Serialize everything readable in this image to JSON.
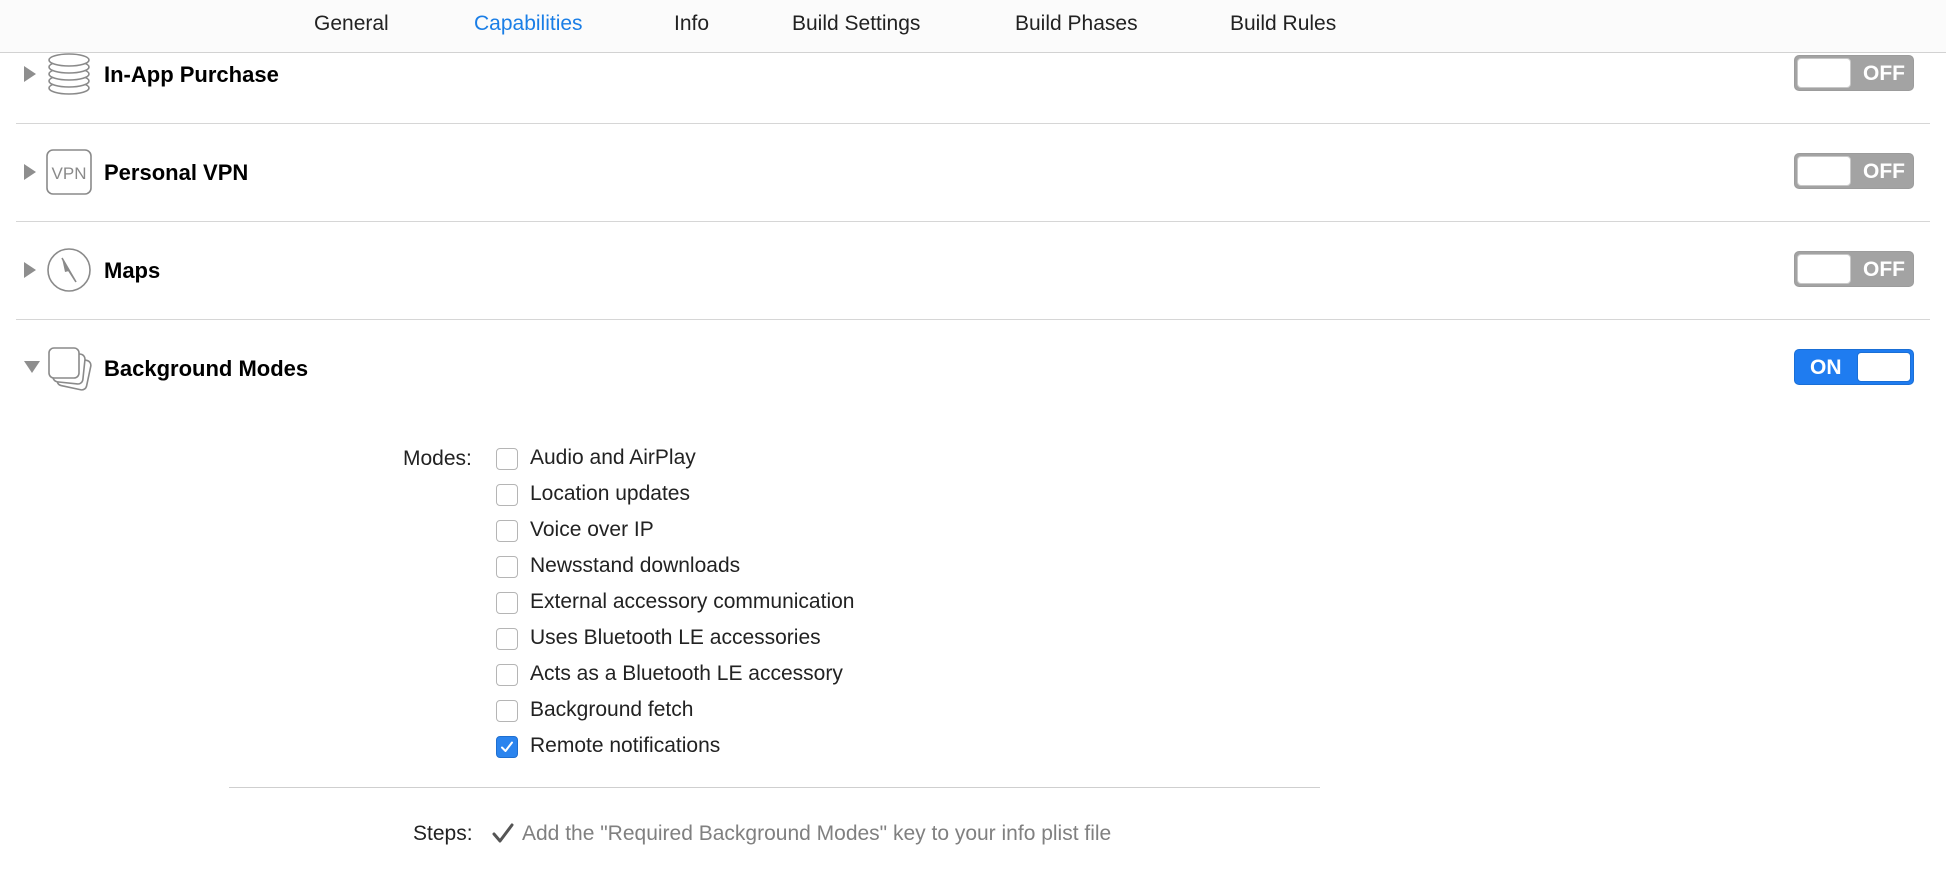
{
  "tabs": [
    {
      "label": "General",
      "active": false
    },
    {
      "label": "Capabilities",
      "active": true
    },
    {
      "label": "Info",
      "active": false
    },
    {
      "label": "Build Settings",
      "active": false
    },
    {
      "label": "Build Phases",
      "active": false
    },
    {
      "label": "Build Rules",
      "active": false
    }
  ],
  "capabilities": [
    {
      "title": "In-App Purchase",
      "icon": "coins-stack-icon",
      "expanded": false,
      "toggle": "OFF"
    },
    {
      "title": "Personal VPN",
      "icon": "vpn-icon",
      "vpn_text": "VPN",
      "expanded": false,
      "toggle": "OFF"
    },
    {
      "title": "Maps",
      "icon": "compass-icon",
      "expanded": false,
      "toggle": "OFF"
    },
    {
      "title": "Background Modes",
      "icon": "stacked-layers-icon",
      "expanded": true,
      "toggle": "ON"
    }
  ],
  "background_modes": {
    "modes_label": "Modes:",
    "modes": [
      {
        "label": "Audio and AirPlay",
        "checked": false
      },
      {
        "label": "Location updates",
        "checked": false
      },
      {
        "label": "Voice over IP",
        "checked": false
      },
      {
        "label": "Newsstand downloads",
        "checked": false
      },
      {
        "label": "External accessory communication",
        "checked": false
      },
      {
        "label": "Uses Bluetooth LE accessories",
        "checked": false
      },
      {
        "label": "Acts as a Bluetooth LE accessory",
        "checked": false
      },
      {
        "label": "Background fetch",
        "checked": false
      },
      {
        "label": "Remote notifications",
        "checked": true
      }
    ],
    "steps_label": "Steps:",
    "step_text": "Add the \"Required Background Modes\" key to your info plist file"
  },
  "colors": {
    "accent": "#1a7ee6",
    "toggle_on": "#1f7cf0",
    "toggle_off": "#a3a3a3",
    "step_text": "#808080"
  }
}
